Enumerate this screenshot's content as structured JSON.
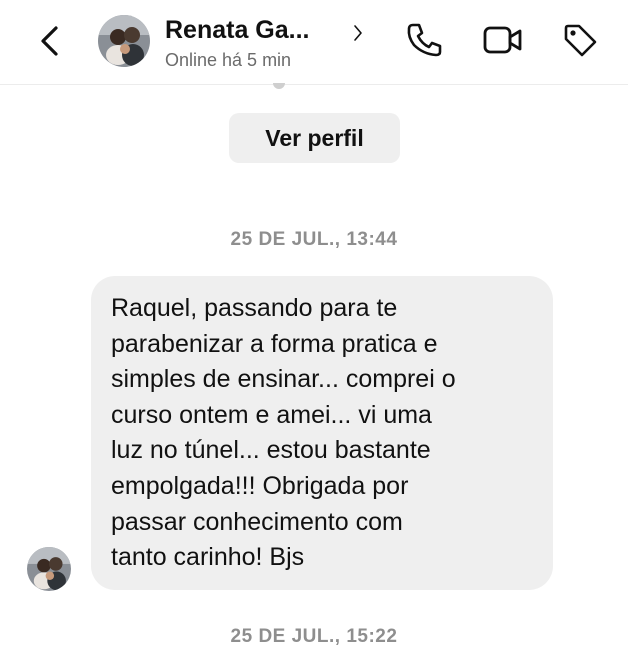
{
  "header": {
    "contact_name": "Renata Ga...",
    "status": "Online há 5 min",
    "icons": [
      "back-chevron-icon",
      "chevron-right-icon",
      "phone-icon",
      "video-camera-icon",
      "tag-icon"
    ]
  },
  "profile_button_label": "Ver perfil",
  "timestamps": [
    "25 DE JUL., 13:44",
    "25 DE JUL., 15:22"
  ],
  "message": {
    "text": "Raquel, passando para te\nparabenizar a forma pratica e\nsimples de ensinar... comprei o\ncurso ontem e amei... vi uma\nluz no túnel... estou bastante\nempolgada!!! Obrigada por\npassar conhecimento com\ntanto carinho! Bjs"
  },
  "colors": {
    "bubble_bg": "#efefef",
    "timestamp_text": "#8e8e8e",
    "status_text": "#6b6b6b"
  }
}
